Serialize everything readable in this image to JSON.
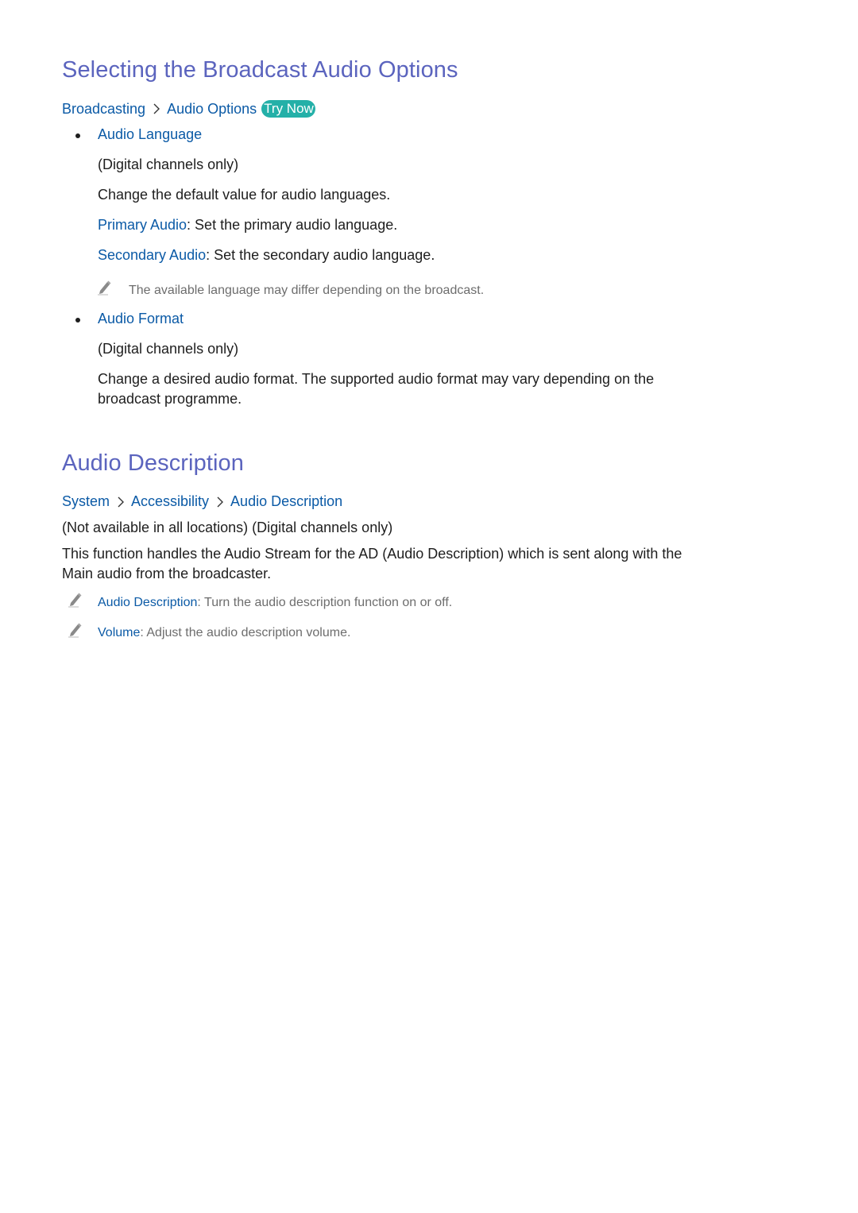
{
  "section1": {
    "title": "Selecting the Broadcast Audio Options",
    "breadcrumb": [
      "Broadcasting",
      "Audio Options"
    ],
    "try_now_label": "Try Now",
    "items": [
      {
        "title": "Audio Language",
        "qualifier": "(Digital channels only)",
        "description": "Change the default value for audio languages.",
        "options": [
          {
            "key": "Primary Audio",
            "text": ": Set the primary audio language."
          },
          {
            "key": "Secondary Audio",
            "text": ": Set the secondary audio language."
          }
        ],
        "note": "The available language may differ depending on the broadcast."
      },
      {
        "title": "Audio Format",
        "qualifier": "(Digital channels only)",
        "description_line1": "Change a desired audio format. The supported audio format may vary depending on the",
        "description_line2": "broadcast programme."
      }
    ]
  },
  "section2": {
    "title": "Audio Description",
    "breadcrumb": [
      "System",
      "Accessibility",
      "Audio Description"
    ],
    "qualifier": "(Not available in all locations) (Digital channels only)",
    "description_line1": "This function handles the Audio Stream for the AD (Audio Description) which is sent along with the",
    "description_line2": "Main audio from the broadcaster.",
    "notes": [
      {
        "key": "Audio Description",
        "text": ": Turn the audio description function on or off."
      },
      {
        "key": "Volume",
        "text": ": Adjust the audio description volume."
      }
    ]
  },
  "icons": {
    "breadcrumb_separator": "chevron-right-icon",
    "note": "pencil-icon",
    "list_bullet": "bullet-icon"
  },
  "colors": {
    "heading": "#5b64be",
    "link": "#0b5aa6",
    "try_now_bg": "#24b0a8",
    "body_text": "#1e1e1e",
    "note_text": "#6d6d6d"
  }
}
